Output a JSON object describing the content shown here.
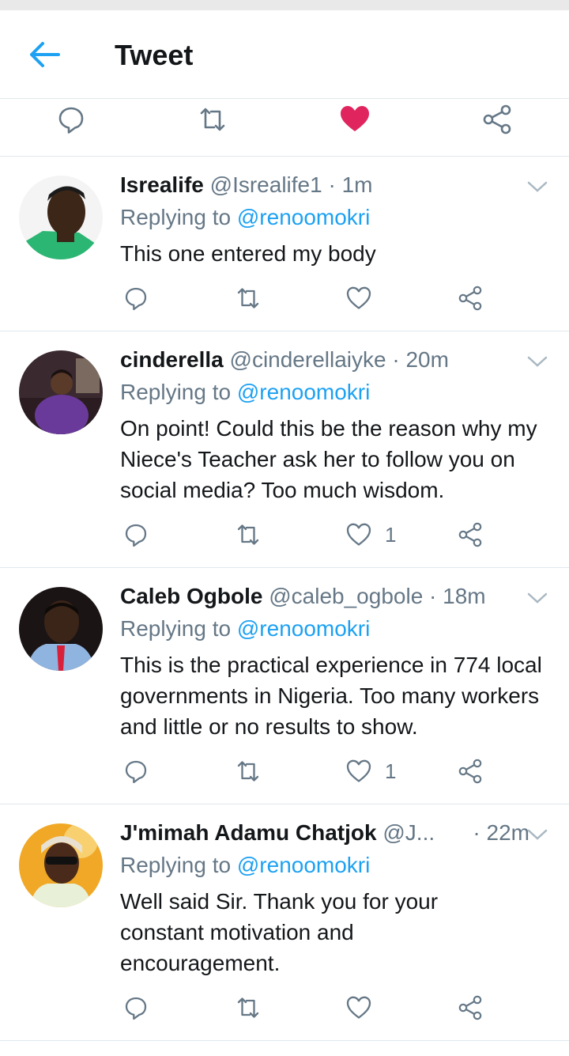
{
  "header": {
    "title": "Tweet",
    "back_icon": "arrow-left-icon"
  },
  "colors": {
    "accent": "#1da1f2",
    "like": "#e0245e",
    "muted": "#657786",
    "text": "#14171a",
    "border": "#e1e8ed"
  },
  "main_actions": {
    "icons": [
      "reply-icon",
      "retweet-icon",
      "heart-filled-icon",
      "share-icon"
    ]
  },
  "tweets": [
    {
      "name": "Isrealife",
      "handle": "@Isrealife1",
      "time": "· 1m",
      "replying_prefix": "Replying to ",
      "replying_to": "@renoomokri",
      "text": "This one entered my body",
      "likes": ""
    },
    {
      "name": "cinderella",
      "handle": "@cinderellaiyke",
      "time": "· 20m",
      "replying_prefix": "Replying to ",
      "replying_to": "@renoomokri",
      "text": "On point! Could this be the reason why my Niece's Teacher ask her to follow you on social media? Too much wisdom.",
      "likes": "1"
    },
    {
      "name": "Caleb Ogbole",
      "handle": "@caleb_ogbole",
      "time": "· 18m",
      "replying_prefix": "Replying to ",
      "replying_to": "@renoomokri",
      "text": "This is the practical experience in 774 local governments in Nigeria. Too many workers and little or no results to show.",
      "likes": "1"
    },
    {
      "name": "J'mimah Adamu Chatjok",
      "handle": "@J...",
      "time": "· 22m",
      "replying_prefix": "Replying to ",
      "replying_to": "@renoomokri",
      "text": "Well said Sir. Thank you for your constant motivation and encouragement.",
      "likes": ""
    }
  ]
}
